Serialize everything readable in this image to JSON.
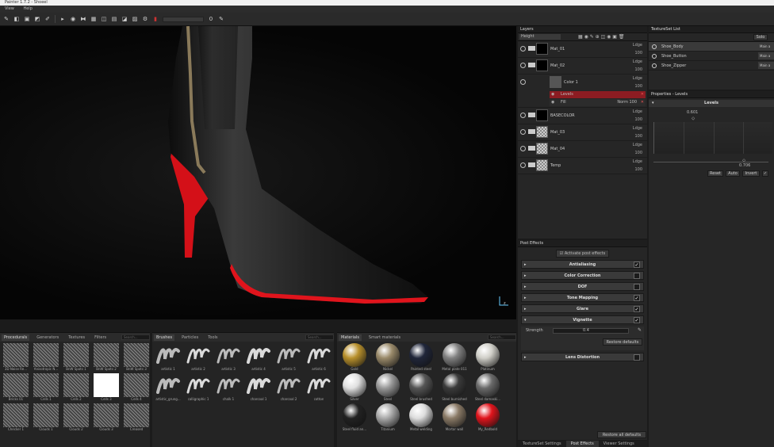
{
  "window": {
    "title": "Painter 1.7.2 - Shoeel"
  },
  "menu": [
    "View",
    "Help"
  ],
  "toolbar": {
    "slider_value": "0"
  },
  "shelf_left": {
    "tabs": [
      "Procedurals",
      "Generators",
      "Textures",
      "Filters"
    ],
    "search_placeholder": "Search...",
    "items": [
      "3D Noise Re...",
      "Anisotropic N...",
      "BnW Spots 1",
      "BnW Spots 2",
      "BnW Spots 3",
      "Bricks 01",
      "Cells 1",
      "Cells 2",
      "Cells 3",
      "Cells 4",
      "Checker 1",
      "Clouds 1",
      "Clouds 2",
      "Clouds 3",
      "Creased"
    ]
  },
  "shelf_brushes": {
    "tabs": [
      "Brushes",
      "Particles",
      "Tools"
    ],
    "search_placeholder": "Search...",
    "items": [
      "artistic 1",
      "artistic 2",
      "artistic 3",
      "artistic 4",
      "artistic 5",
      "artistic 6",
      "artistic_grung...",
      "calligraphic 1",
      "chalk 1",
      "charcoal 1",
      "charcoal 2",
      "cotton"
    ]
  },
  "shelf_materials": {
    "tabs": [
      "Materials",
      "Smart materials"
    ],
    "search_placeholder": "Search...",
    "items": [
      "Gold",
      "Nickel",
      "Painted steel",
      "Metal plate 011",
      "Platinum",
      "Silver",
      "Steel",
      "Steel brushed",
      "Steel burnished",
      "Steel damaski...",
      "Steel fluid an...",
      "Titanium",
      "Metal welding",
      "Mortar wall",
      "My_Redbold"
    ]
  },
  "layers": {
    "title": "Layers",
    "channel": "Height",
    "rows": [
      {
        "name": "Mat_01",
        "blend": "Ldge",
        "opacity": "100"
      },
      {
        "name": "Mat_02",
        "blend": "Ldge",
        "opacity": "100"
      },
      {
        "name": "Color 1",
        "blend": "Ldge",
        "opacity": "100"
      },
      {
        "name": "BASECOLOR",
        "blend": "Ldge",
        "opacity": "100"
      },
      {
        "name": "Mat_03",
        "blend": "Ldge",
        "opacity": "100"
      },
      {
        "name": "Mat_04",
        "blend": "Ldge",
        "opacity": "100"
      },
      {
        "name": "Temp",
        "blend": "Ldge",
        "opacity": "100"
      }
    ],
    "effects": [
      {
        "name": "Levels",
        "blend": "",
        "opacity": ""
      },
      {
        "name": "Fill",
        "blend": "Norm",
        "opacity": "100"
      }
    ]
  },
  "post_effects": {
    "title": "Post Effects",
    "activate_label": "Activate post effects",
    "items": [
      {
        "label": "Antialiasing",
        "checked": true
      },
      {
        "label": "Color Correction",
        "checked": false
      },
      {
        "label": "DOF",
        "checked": false
      },
      {
        "label": "Tone Mapping",
        "checked": true
      },
      {
        "label": "Glare",
        "checked": true
      },
      {
        "label": "Vignette",
        "checked": true
      },
      {
        "label": "Lens Distortion",
        "checked": false
      }
    ],
    "vignette_strength_label": "Strength",
    "vignette_strength_value": "0.4",
    "restore_label": "Restore defaults",
    "restore_all_label": "Restore all defaults"
  },
  "bottom_tabs": [
    "TextureSet Settings",
    "Post Effects",
    "Viewer Settings"
  ],
  "textureset": {
    "title": "TextureSet List",
    "solo_label": "Solo",
    "items": [
      {
        "name": "Shoe_Body",
        "mat": "Main a"
      },
      {
        "name": "Shoe_Button",
        "mat": "Main a"
      },
      {
        "name": "Shoe_Zipper",
        "mat": "Main a"
      }
    ]
  },
  "properties": {
    "title": "Properties - Levels",
    "section": "Levels",
    "value_top": "0.601",
    "value_bottom": "0.706",
    "buttons": [
      "Reset",
      "Auto",
      "Invert"
    ]
  },
  "colors": {
    "heel_red": "#e0141c",
    "leather": "#2a2a2a",
    "layer_selected": "#8c1c22"
  }
}
